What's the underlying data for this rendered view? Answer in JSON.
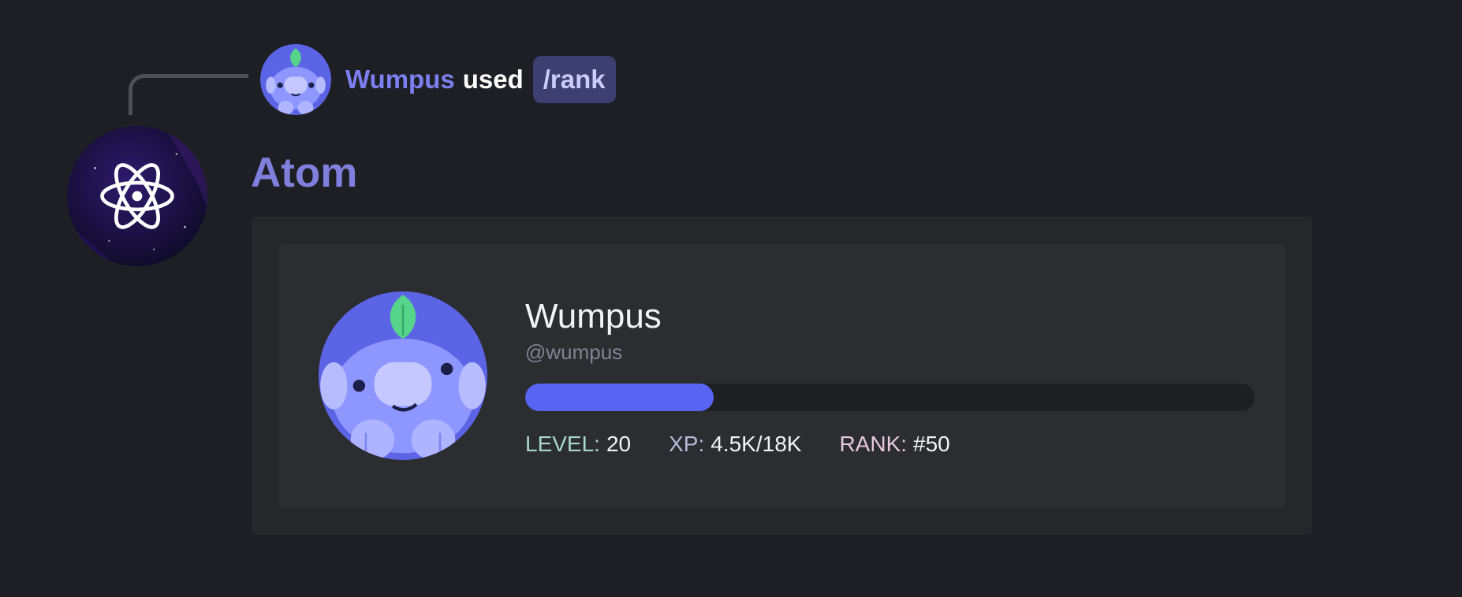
{
  "reply": {
    "user": "Wumpus",
    "verb": "used",
    "command": "/rank"
  },
  "bot": {
    "name": "Atom",
    "avatar_icon": "atom-icon"
  },
  "rank_card": {
    "display_name": "Wumpus",
    "handle": "@wumpus",
    "progress_fraction": 0.258,
    "level_label": "LEVEL:",
    "level_value": "20",
    "xp_label": "XP:",
    "xp_value": "4.5K/18K",
    "rank_label": "RANK:",
    "rank_value": "#50"
  },
  "colors": {
    "background": "#1e1f24",
    "accent": "#5865f2",
    "username": "#7b7ff0",
    "bot_name": "#7f7fdc",
    "command_pill": "#3c3f70"
  }
}
